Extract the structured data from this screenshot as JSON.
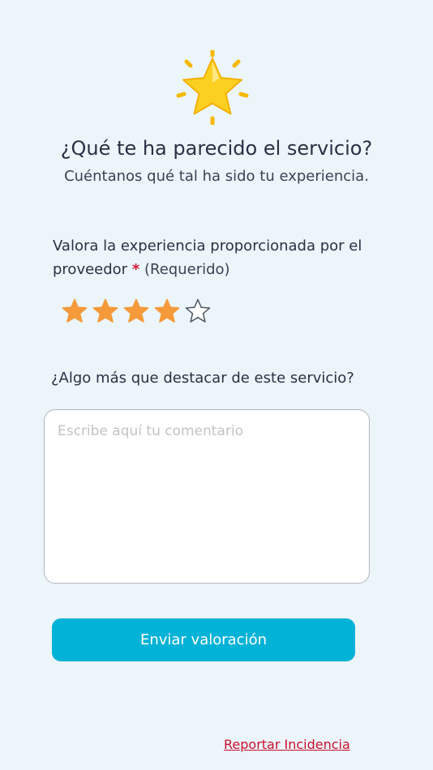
{
  "header": {
    "icon": "glowing-star-icon",
    "title": "¿Qué te ha parecido el servicio?",
    "subtitle": "Cuéntanos qué tal ha sido tu experiencia."
  },
  "rating": {
    "label": "Valora la experiencia proporcionada por el proveedor",
    "required_marker": "*",
    "required_text": "(Requerido)",
    "value": 4,
    "max": 5,
    "filled_color": "#f59a3a",
    "empty_color": "#ffffff"
  },
  "comment": {
    "label": "¿Algo más que destacar de este servicio?",
    "value": "",
    "placeholder": "Escribe aquí tu comentario"
  },
  "submit": {
    "label": "Enviar valoración",
    "color": "#03b2d7"
  },
  "footer": {
    "report_link": "Reportar Incidencia",
    "link_color": "#c8102e"
  }
}
